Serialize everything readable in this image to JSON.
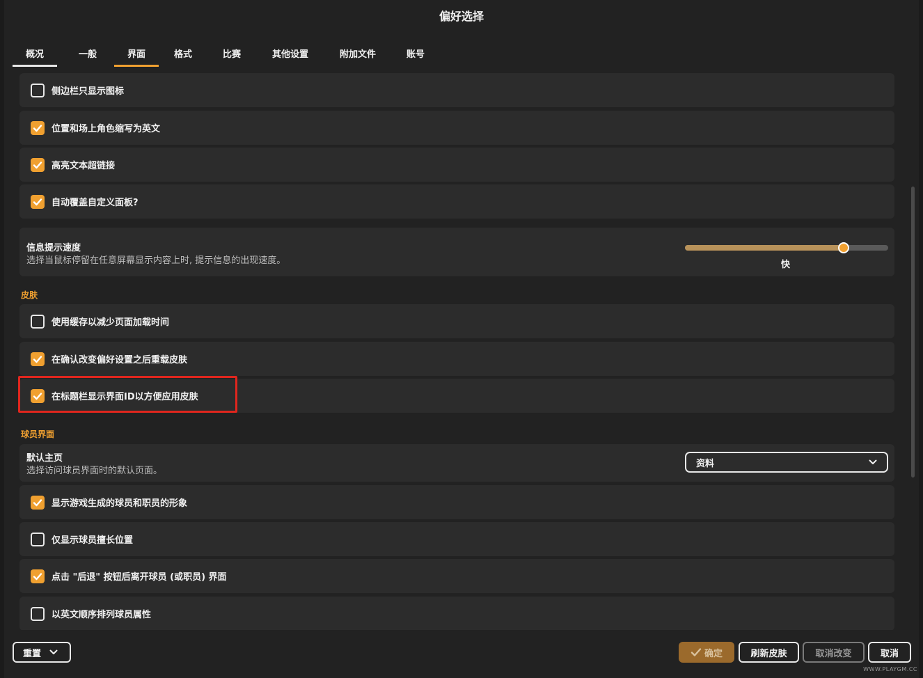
{
  "window": {
    "title": "偏好选择"
  },
  "tabs": [
    {
      "label": "概况"
    },
    {
      "label": "一般"
    },
    {
      "label": "界面",
      "active": true
    },
    {
      "label": "格式"
    },
    {
      "label": "比赛"
    },
    {
      "label": "其他设置"
    },
    {
      "label": "附加文件"
    },
    {
      "label": "账号"
    }
  ],
  "options_top": [
    {
      "label": "侧边栏只显示图标",
      "checked": false
    },
    {
      "label": "位置和场上角色缩写为英文",
      "checked": true
    },
    {
      "label": "高亮文本超链接",
      "checked": true
    },
    {
      "label": "自动覆盖自定义面板?",
      "checked": true
    }
  ],
  "tooltip_speed": {
    "title": "信息提示速度",
    "description": "选择当鼠标停留在任意屏幕显示内容上时, 提示信息的出现速度。",
    "value_label": "快",
    "level": 0.78
  },
  "skin_section": {
    "title": "皮肤",
    "options": [
      {
        "label": "使用缓存以减少页面加载时间",
        "checked": false
      },
      {
        "label": "在确认改变偏好设置之后重载皮肤",
        "checked": true
      },
      {
        "label": "在标题栏显示界面ID以方便应用皮肤",
        "checked": true
      }
    ]
  },
  "player_section": {
    "title": "球员界面",
    "default_page": {
      "title": "默认主页",
      "description": "选择访问球员界面时的默认页面。",
      "selected": "资料"
    },
    "options": [
      {
        "label": "显示游戏生成的球员和职员的形象",
        "checked": true
      },
      {
        "label": "仅显示球员擅长位置",
        "checked": false
      },
      {
        "label": "点击 \"后退\" 按钮后离开球员 (或职员) 界面",
        "checked": true
      },
      {
        "label": "以英文顺序排列球员属性",
        "checked": false
      }
    ]
  },
  "footer": {
    "reset_label": "重置",
    "confirm_label": "确定",
    "refresh_skin_label": "刷新皮肤",
    "undo_label": "取消改变",
    "cancel_label": "取消"
  },
  "colors": {
    "accent": "#f0a030",
    "highlight": "#e0261e",
    "background": "#222222",
    "row": "#2c2c2c"
  },
  "watermark": "WWW.PLAYGM.CC"
}
